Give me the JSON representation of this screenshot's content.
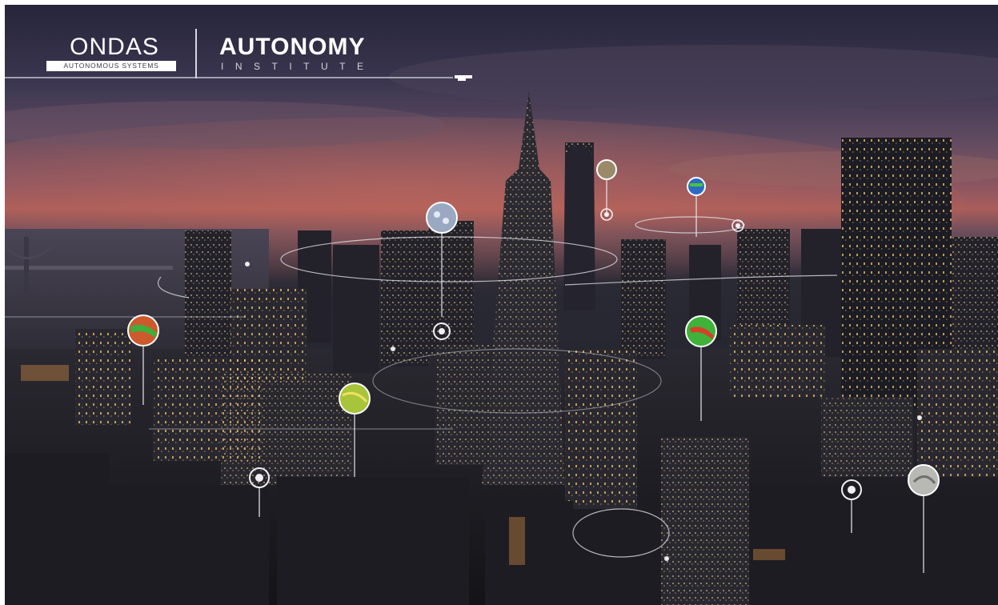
{
  "logo": {
    "ondas_name": "ONDAS",
    "ondas_tagline": "AUTONOMOUS SYSTEMS",
    "institute_name": "AUTONOMY",
    "institute_subtitle": "INSTITUTE"
  },
  "colors": {
    "sky_top": "#26253a",
    "sunset_glow": "#a95d5a",
    "building_dark": "#1b1b22",
    "window_light": "#f3c36a",
    "hotspot_ring": "#e8e8ee"
  },
  "icons": {
    "drone": "drone-icon",
    "hotspot": "target-ring-icon"
  }
}
